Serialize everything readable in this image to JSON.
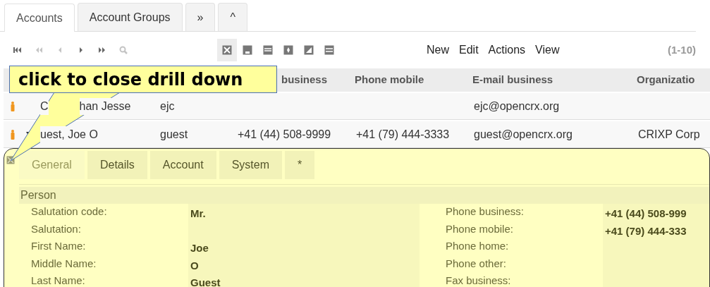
{
  "tabs": [
    {
      "label": "Accounts",
      "selected": true
    },
    {
      "label": "Account Groups",
      "selected": false
    },
    {
      "label": "»",
      "selected": false
    },
    {
      "label": "^",
      "selected": false
    }
  ],
  "nav_buttons": [
    {
      "kind": "first",
      "disabled": false
    },
    {
      "kind": "fast-back",
      "disabled": true
    },
    {
      "kind": "back",
      "disabled": true
    },
    {
      "kind": "forward",
      "disabled": false
    },
    {
      "kind": "fast-forward",
      "disabled": false
    },
    {
      "kind": "search",
      "disabled": true
    }
  ],
  "view_buttons": [
    {
      "kind": "cross",
      "selected": true
    },
    {
      "kind": "notch",
      "selected": false
    },
    {
      "kind": "split",
      "selected": false
    },
    {
      "kind": "star",
      "selected": false
    },
    {
      "kind": "corner",
      "selected": false
    },
    {
      "kind": "lines",
      "selected": false
    }
  ],
  "menus": [
    "New",
    "Edit",
    "Actions",
    "View"
  ],
  "range": "(1-10)",
  "table": {
    "columns": [
      {
        "label": "business"
      },
      {
        "label": "Phone mobile"
      },
      {
        "label": "E-mail business"
      },
      {
        "label": "Organizatio"
      }
    ],
    "rows": [
      {
        "name_parts": [
          "C",
          "han Jesse"
        ],
        "expanded": false,
        "cells": {
          "alias": "ejc",
          "email": "ejc@opencrx.org"
        }
      },
      {
        "name_parts": [
          "uest, Joe O"
        ],
        "expanded": true,
        "cells": {
          "alias": "guest",
          "phone": "+41 (44) 508-9999",
          "mobile": "+41 (79) 444-3333",
          "email": "guest@opencrx.org",
          "org": "CRIXP Corp"
        }
      }
    ]
  },
  "callout": "click to close drill down",
  "detail": {
    "tabs": [
      {
        "label": "General",
        "selected": true
      },
      {
        "label": "Details",
        "selected": false
      },
      {
        "label": "Account",
        "selected": false
      },
      {
        "label": "System",
        "selected": false
      },
      {
        "label": "*",
        "selected": false
      }
    ],
    "section": "Person",
    "left_fields": [
      {
        "label": "Salutation code:",
        "value": "Mr."
      },
      {
        "label": "Salutation:"
      },
      {
        "label": "First Name:",
        "value": "Joe"
      },
      {
        "label": "Middle Name:",
        "value": "O"
      },
      {
        "label": "Last Name:",
        "value": "Guest"
      }
    ],
    "right_fields": [
      {
        "label": "Phone business:",
        "value": "+41 (44) 508-999"
      },
      {
        "label": "Phone mobile:",
        "value": "+41 (79) 444-333"
      },
      {
        "label": "Phone home:"
      },
      {
        "label": "Phone other:"
      },
      {
        "label": "Fax business:"
      }
    ]
  }
}
